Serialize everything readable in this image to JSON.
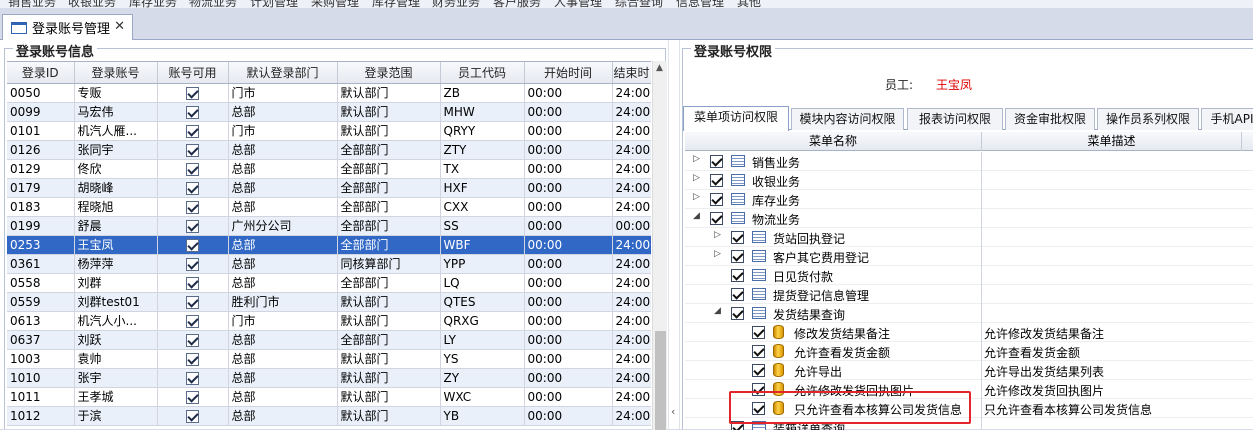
{
  "menubar": [
    "销售业务",
    "收银业务",
    "库存业务",
    "物流业务",
    "计划管理",
    "采购管理",
    "库存管理",
    "财务业务",
    "客户服务",
    "人事管理",
    "综合查询",
    "信息管理",
    "其他"
  ],
  "doc_tab": {
    "title": "登录账号管理",
    "close": "✕"
  },
  "left_panel": {
    "title": "登录账号信息",
    "columns": [
      "登录ID",
      "登录账号",
      "账号可用",
      "默认登录部门",
      "登录范围",
      "员工代码",
      "开始时间",
      "结束时"
    ],
    "rows": [
      [
        "0050",
        "专贩",
        true,
        "门市",
        "默认部门",
        "ZB",
        "00:00",
        "24:00"
      ],
      [
        "0099",
        "马宏伟",
        true,
        "总部",
        "默认部门",
        "MHW",
        "00:00",
        "24:00"
      ],
      [
        "0101",
        "机汽人雁...",
        true,
        "门市",
        "默认部门",
        "QRYY",
        "00:00",
        "24:00"
      ],
      [
        "0126",
        "张同宇",
        true,
        "总部",
        "全部部门",
        "ZTY",
        "00:00",
        "24:00"
      ],
      [
        "0129",
        "佟欣",
        true,
        "总部",
        "全部部门",
        "TX",
        "00:00",
        "24:00"
      ],
      [
        "0179",
        "胡晓峰",
        true,
        "总部",
        "全部部门",
        "HXF",
        "00:00",
        "24:00"
      ],
      [
        "0183",
        "程晓旭",
        true,
        "总部",
        "全部部门",
        "CXX",
        "00:00",
        "24:00"
      ],
      [
        "0199",
        "舒晨",
        true,
        "广州分公司",
        "全部部门",
        "SS",
        "00:00",
        "00:00"
      ],
      [
        "0253",
        "王宝凤",
        true,
        "总部",
        "全部部门",
        "WBF",
        "00:00",
        "24:00"
      ],
      [
        "0361",
        "杨萍萍",
        true,
        "总部",
        "同核算部门",
        "YPP",
        "00:00",
        "24:00"
      ],
      [
        "0558",
        "刘群",
        true,
        "总部",
        "全部部门",
        "LQ",
        "00:00",
        "24:00"
      ],
      [
        "0559",
        "刘群test01",
        true,
        "胜利门市",
        "默认部门",
        "QTES",
        "00:00",
        "24:00"
      ],
      [
        "0613",
        "机汽人小...",
        true,
        "门市",
        "默认部门",
        "QRXG",
        "00:00",
        "24:00"
      ],
      [
        "0637",
        "刘跃",
        true,
        "总部",
        "全部部门",
        "LY",
        "00:00",
        "24:00"
      ],
      [
        "1003",
        "袁帅",
        true,
        "总部",
        "默认部门",
        "YS",
        "00:00",
        "24:00"
      ],
      [
        "1010",
        "张宇",
        true,
        "总部",
        "默认部门",
        "ZY",
        "00:00",
        "24:00"
      ],
      [
        "1011",
        "王孝城",
        true,
        "总部",
        "默认部门",
        "WXC",
        "00:00",
        "24:00"
      ],
      [
        "1012",
        "于滨",
        true,
        "总部",
        "默认部门",
        "YB",
        "00:00",
        "24:00"
      ]
    ],
    "selected_row": 8
  },
  "right_panel": {
    "title": "登录账号权限",
    "employee_label": "员工:",
    "employee_name": "王宝凤",
    "tabs": [
      "菜单项访问权限",
      "模块内容访问权限",
      "报表访问权限",
      "资金审批权限",
      "操作员系列权限",
      "手机API"
    ],
    "tree_columns": [
      "菜单名称",
      "菜单描述"
    ],
    "tree": [
      {
        "level": 0,
        "expander": "right",
        "icon": "node",
        "name": "销售业务",
        "desc": ""
      },
      {
        "level": 0,
        "expander": "right",
        "icon": "node",
        "name": "收银业务",
        "desc": ""
      },
      {
        "level": 0,
        "expander": "right",
        "icon": "node",
        "name": "库存业务",
        "desc": ""
      },
      {
        "level": 0,
        "expander": "down",
        "icon": "node",
        "name": "物流业务",
        "desc": ""
      },
      {
        "level": 1,
        "expander": "right",
        "icon": "node",
        "name": "货站回执登记",
        "desc": ""
      },
      {
        "level": 1,
        "expander": "right",
        "icon": "node",
        "name": "客户其它费用登记",
        "desc": ""
      },
      {
        "level": 1,
        "expander": "none",
        "icon": "node",
        "name": "日见货付款",
        "desc": ""
      },
      {
        "level": 1,
        "expander": "none",
        "icon": "node",
        "name": "提货登记信息管理",
        "desc": ""
      },
      {
        "level": 1,
        "expander": "down",
        "icon": "node",
        "name": "发货结果查询",
        "desc": ""
      },
      {
        "level": 2,
        "expander": "none",
        "icon": "leaf",
        "name": "修改发货结果备注",
        "desc": "允许修改发货结果备注"
      },
      {
        "level": 2,
        "expander": "none",
        "icon": "leaf",
        "name": "允许查看发货金额",
        "desc": "允许查看发货金额"
      },
      {
        "level": 2,
        "expander": "none",
        "icon": "leaf",
        "name": "允许导出",
        "desc": "允许导出发货结果列表"
      },
      {
        "level": 2,
        "expander": "none",
        "icon": "leaf",
        "name": "允许修改发货回执图片",
        "desc": "允许修改发货回执图片"
      },
      {
        "level": 2,
        "expander": "none",
        "icon": "leaf",
        "name": "只允许查看本核算公司发货信息",
        "desc": "只允许查看本核算公司发货信息"
      },
      {
        "level": 1,
        "expander": "none",
        "icon": "node",
        "name": "装箱详单查询",
        "desc": ""
      }
    ]
  },
  "highlight_color": "#e3242b",
  "selection_color": "#3168c6"
}
